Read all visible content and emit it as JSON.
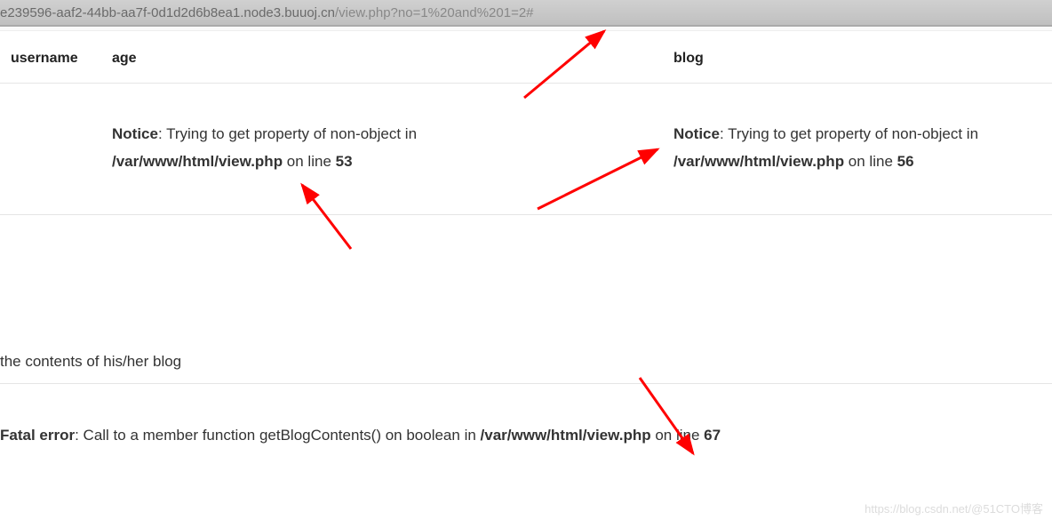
{
  "url": {
    "domain": "e239596-aaf2-44bb-aa7f-0d1d2d6b8ea1.node3.buuoj.cn",
    "path": "/view.php?no=1%20and%201=2#"
  },
  "table": {
    "headers": {
      "username": "username",
      "age": "age",
      "blog": "blog"
    },
    "cells": {
      "age_notice_label": "Notice",
      "age_notice_msg": ": Trying to get property of non-object in ",
      "age_notice_path": "/var/www/html/view.php",
      "age_notice_online": " on line ",
      "age_notice_line": "53",
      "blog_notice_label": "Notice",
      "blog_notice_msg": ": Trying to get property of non-object in ",
      "blog_notice_path": "/var/www/html/view.php",
      "blog_notice_online": " on line ",
      "blog_notice_line": "56"
    }
  },
  "section": {
    "title": "the contents of his/her blog"
  },
  "fatal": {
    "label": "Fatal error",
    "msg": ": Call to a member function getBlogContents() on boolean in ",
    "path": "/var/www/html/view.php",
    "online": " on line ",
    "line": "67"
  },
  "watermark": "https://blog.csdn.net/@51CTO博客"
}
